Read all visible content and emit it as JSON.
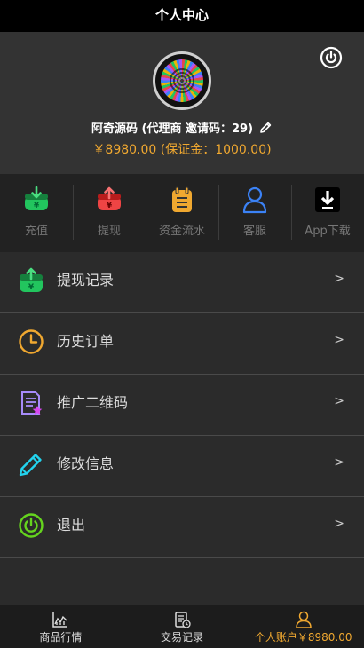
{
  "header": {
    "title": "个人中心"
  },
  "profile": {
    "name_line": "阿奇源码 (代理商 邀请码：29)",
    "balance_line": "￥8980.00 (保证金：1000.00)"
  },
  "quick_actions": [
    {
      "label": "充值",
      "icon": "deposit-icon",
      "color": "#22c55e"
    },
    {
      "label": "提现",
      "icon": "withdraw-icon",
      "color": "#ef4444"
    },
    {
      "label": "资金流水",
      "icon": "ledger-icon",
      "color": "#f0a830"
    },
    {
      "label": "客服",
      "icon": "user-icon",
      "color": "#3b82f6"
    },
    {
      "label": "App下载",
      "icon": "download-icon",
      "color": "#000000"
    }
  ],
  "menu": [
    {
      "label": "提现记录",
      "chevron": ">",
      "icon": "withdraw-record-icon"
    },
    {
      "label": "历史订单",
      "chevron": ">",
      "icon": "clock-icon"
    },
    {
      "label": "推广二维码",
      "chevron": ">",
      "icon": "document-star-icon"
    },
    {
      "label": "修改信息",
      "chevron": ">",
      "icon": "pencil-icon"
    },
    {
      "label": "退出",
      "chevron": ">",
      "icon": "power-icon"
    }
  ],
  "tabbar": [
    {
      "label": "商品行情",
      "icon": "chart-icon",
      "active": false
    },
    {
      "label": "交易记录",
      "icon": "receipt-icon",
      "active": false
    },
    {
      "label": "个人账户￥8980.00",
      "icon": "person-icon",
      "active": true
    }
  ],
  "colors": {
    "accent": "#f0a830",
    "bg": "#2b2b2b",
    "header": "#000000"
  }
}
